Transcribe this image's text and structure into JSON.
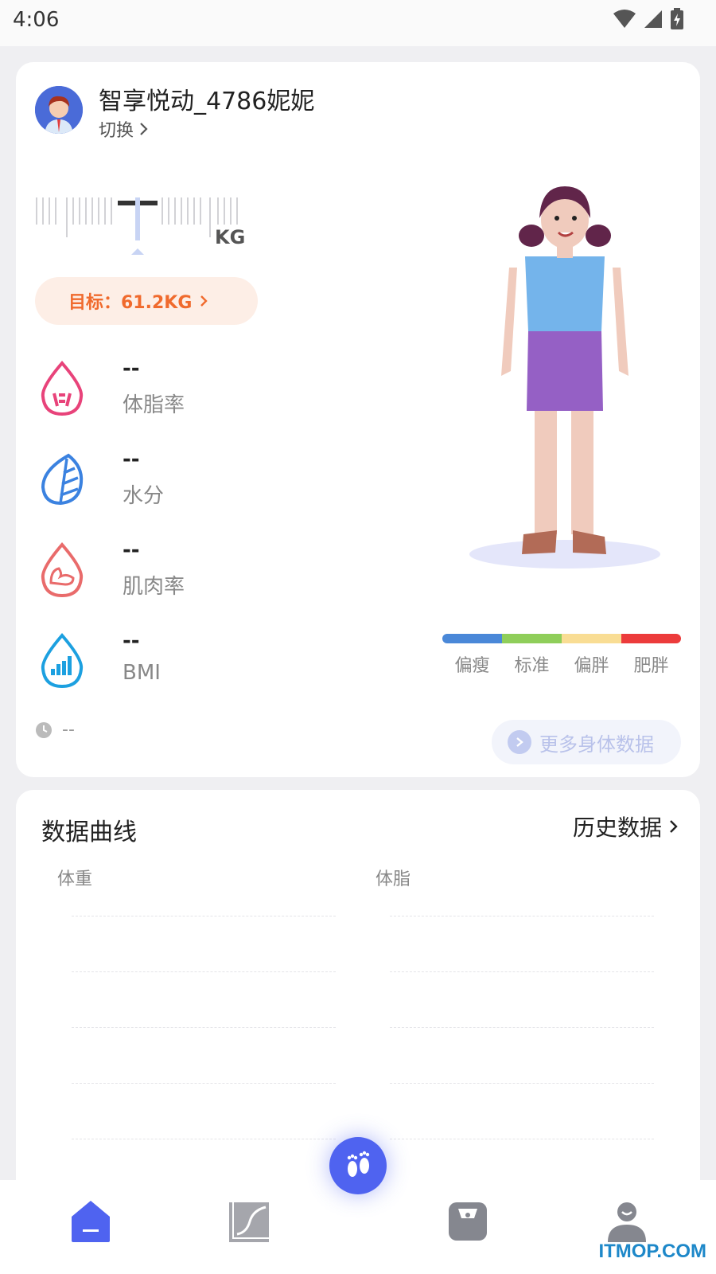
{
  "status_bar": {
    "time": "4:06"
  },
  "profile": {
    "name": "智享悦动_4786妮妮",
    "switch_label": "切换"
  },
  "weight": {
    "unit": "KG",
    "goal_label": "目标：61.2KG"
  },
  "metrics": [
    {
      "value": "--",
      "label": "体脂率",
      "icon": "body-fat-icon",
      "color": "#e8437a"
    },
    {
      "value": "--",
      "label": "水分",
      "icon": "water-icon",
      "color": "#3b82e0"
    },
    {
      "value": "--",
      "label": "肌肉率",
      "icon": "muscle-icon",
      "color": "#e96b6b"
    },
    {
      "value": "--",
      "label": "BMI",
      "icon": "bmi-icon",
      "color": "#1ca0e0"
    }
  ],
  "measure_time": "--",
  "bmi_scale": {
    "labels": [
      "偏瘦",
      "标准",
      "偏胖",
      "肥胖"
    ],
    "colors": [
      "#4a88d8",
      "#8fce5a",
      "#f9dd94",
      "#ec3b3b"
    ]
  },
  "more_data_label": "更多身体数据",
  "curves": {
    "title": "数据曲线",
    "history_label": "历史数据",
    "columns": [
      "体重",
      "体脂"
    ]
  },
  "bottom_nav": {
    "items": [
      "home-icon",
      "chart-icon",
      "footprint-icon",
      "scale-icon",
      "profile-icon"
    ],
    "accent": "#4f63f0"
  },
  "watermark": "ITMOP.COM"
}
